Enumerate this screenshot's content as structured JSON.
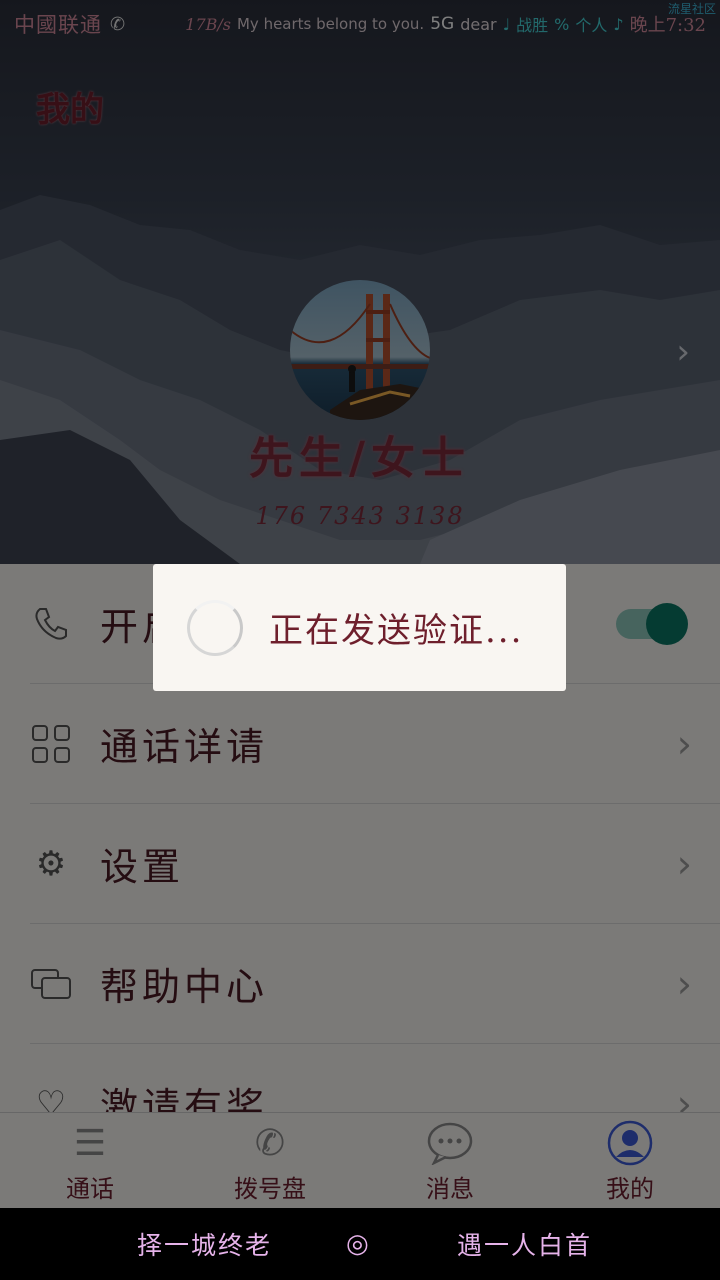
{
  "status_bar": {
    "carrier": "中國联通",
    "speed": "17B/s",
    "motto": "My hearts belong to you.",
    "network": "5G",
    "dear": "dear",
    "music_note": "♩",
    "win": "战胜",
    "signal": "%",
    "personal": "个人",
    "time": "晚上7:32",
    "corner_tag": "流星社区"
  },
  "header": {
    "title": "我的",
    "user_name": "先生/女士",
    "phone": "176 7343 3138"
  },
  "menu": {
    "items": [
      {
        "label": "开启",
        "icon": "phone-icon",
        "control": "toggle",
        "toggle_on": true
      },
      {
        "label": "通话详请",
        "icon": "grid-icon",
        "control": "chevron"
      },
      {
        "label": "设置",
        "icon": "gear-icon",
        "control": "chevron"
      },
      {
        "label": "帮助中心",
        "icon": "chat-icon",
        "control": "chevron"
      },
      {
        "label": "激请有奖",
        "icon": "heart-icon",
        "control": "chevron"
      }
    ]
  },
  "tabs": [
    {
      "label": "通话",
      "icon": "list-icon"
    },
    {
      "label": "拨号盘",
      "icon": "phone-icon"
    },
    {
      "label": "消息",
      "icon": "message-icon"
    },
    {
      "label": "我的",
      "icon": "user-icon",
      "active": true
    }
  ],
  "dialog": {
    "message": "正在发送验证..."
  },
  "navbar": {
    "left": "择一城终老",
    "center": "◎",
    "right": "遇一人白首"
  },
  "colors": {
    "accent_text": "#6e1f2c",
    "toggle_on": "#0b7764",
    "nav_text": "#e6b3ea"
  }
}
